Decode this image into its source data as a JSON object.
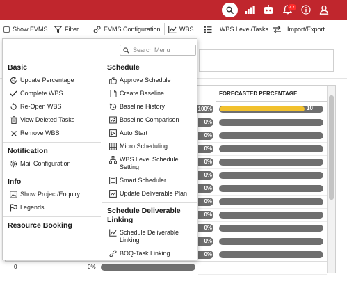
{
  "header": {
    "notification_count": "47",
    "colors": {
      "header_bg": "#c0262d",
      "badge_bg": "#ff2b2b"
    },
    "icons": [
      "search-icon",
      "bar-chart-icon",
      "chatbot-icon",
      "bell-icon",
      "info-icon",
      "user-icon"
    ]
  },
  "toolbar": {
    "show_evms": "Show EVMS",
    "filter": "Filter",
    "evms_configuration": "EVMS Configuration",
    "wbs": "WBS",
    "wbs_level_tasks": "WBS Level/Tasks",
    "import_export": "Import/Export"
  },
  "grid": {
    "column_header": "FORECASTED PERCENTAGE",
    "rows": [
      {
        "pct_label": "100%",
        "bar_label": "10",
        "fill": 1.0
      },
      {
        "pct_label": "0%"
      },
      {
        "pct_label": "0%"
      },
      {
        "pct_label": "0%"
      },
      {
        "pct_label": "0%"
      },
      {
        "pct_label": "0%"
      },
      {
        "pct_label": "0%"
      },
      {
        "pct_label": "0%"
      },
      {
        "pct_label": "0%"
      },
      {
        "pct_label": "0%"
      },
      {
        "pct_label": "0%"
      },
      {
        "pct_label": "0%"
      },
      {
        "pct_label": "0%"
      }
    ],
    "footer": {
      "zero": "0",
      "pct": "0%"
    }
  },
  "menu": {
    "search_placeholder": "Search Menu",
    "basic": {
      "title": "Basic",
      "items": [
        "Update Percentage",
        "Complete WBS",
        "Re-Open WBS",
        "View Deleted Tasks",
        "Remove WBS"
      ]
    },
    "notification": {
      "title": "Notification",
      "items": [
        "Mail Configuration"
      ]
    },
    "info": {
      "title": "Info",
      "items": [
        "Show Project/Enquiry",
        "Legends"
      ]
    },
    "resource_booking": {
      "title": "Resource Booking"
    },
    "schedule": {
      "title": "Schedule",
      "items": [
        "Approve Schedule",
        "Create Baseline",
        "Baseline History",
        "Baseline Comparison",
        "Auto Start",
        "Micro Scheduling",
        "WBS Level Schedule Setting",
        "Smart Scheduler",
        "Update Deliverable Plan"
      ]
    },
    "schedule_deliverable": {
      "title": "Schedule Deliverable Linking",
      "items": [
        "Schedule Deliverable Linking",
        "BOQ-Task Linking"
      ]
    }
  }
}
